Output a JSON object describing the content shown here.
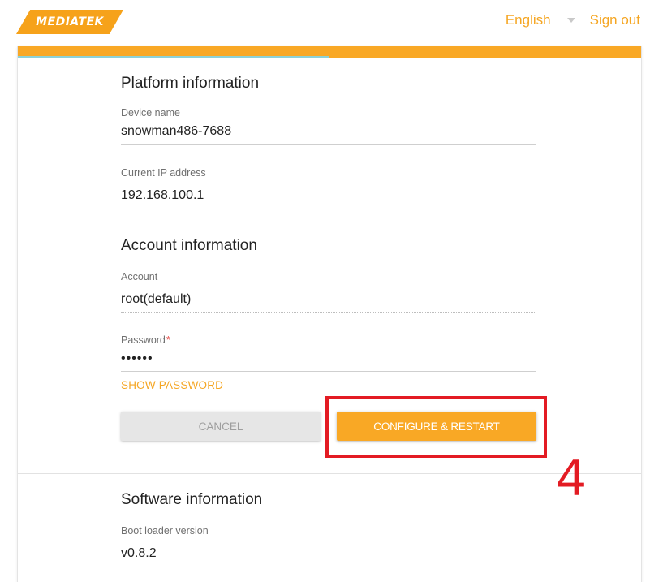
{
  "header": {
    "logo_text": "MEDIATEK",
    "language": "English",
    "sign_out": "Sign out"
  },
  "progress": {
    "value": 1.0
  },
  "platform": {
    "title": "Platform information",
    "device_name_label": "Device name",
    "device_name_value": "snowman486-7688",
    "ip_label": "Current IP address",
    "ip_value": "192.168.100.1"
  },
  "account": {
    "title": "Account information",
    "account_label": "Account",
    "account_value": "root(default)",
    "password_label": "Password",
    "password_required_mark": "*",
    "password_value": "••••••",
    "show_password": "SHOW PASSWORD"
  },
  "actions": {
    "cancel": "CANCEL",
    "configure": "CONFIGURE & RESTART"
  },
  "software": {
    "title": "Software information",
    "bootloader_label": "Boot loader version",
    "bootloader_value": "v0.8.2"
  },
  "annotation": {
    "step": "4"
  },
  "colors": {
    "accent": "#f9a825",
    "link": "#f5a623",
    "annotation_red": "#e31b23",
    "progress_teal": "#8ed1d6"
  }
}
